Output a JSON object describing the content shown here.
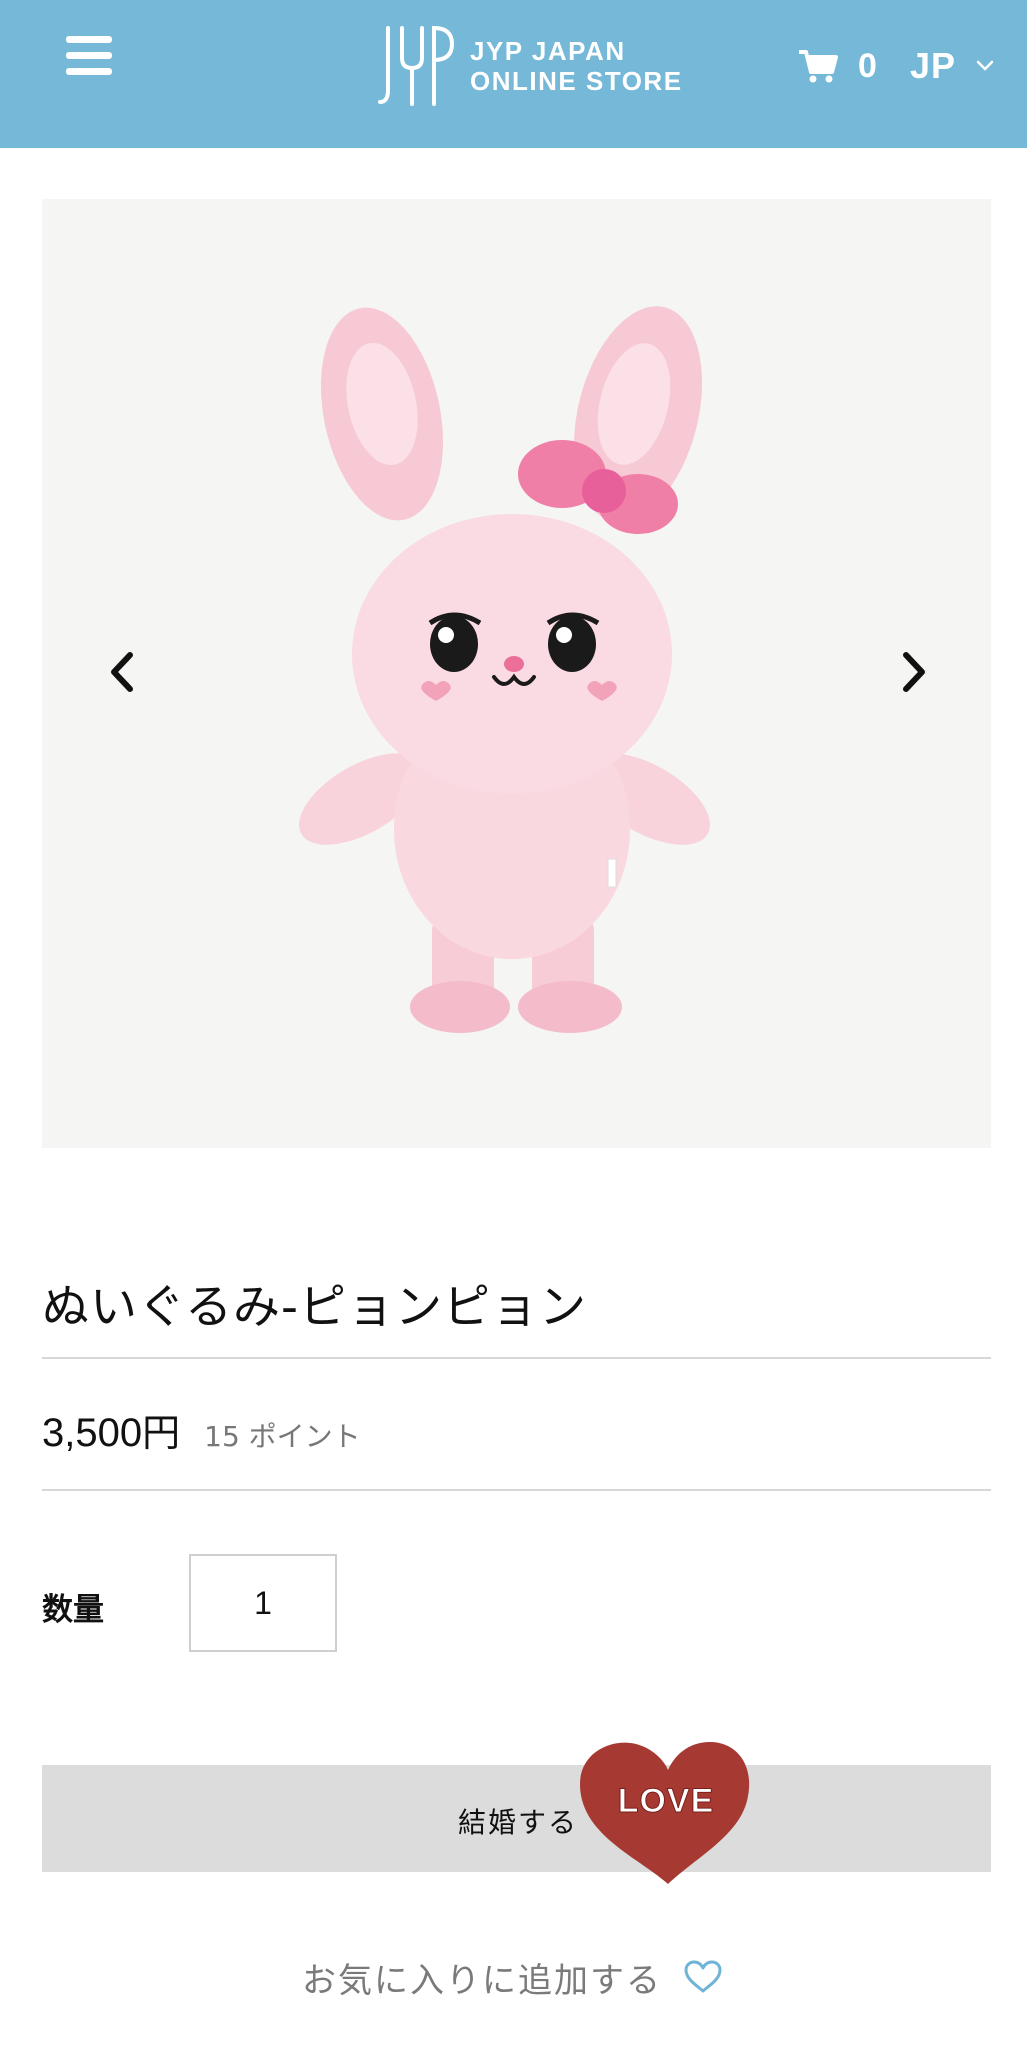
{
  "header": {
    "brand_line1": "JYP JAPAN",
    "brand_line2": "ONLINE STORE",
    "logo_mark": "JYP",
    "cart_count": "0",
    "language": "JP",
    "menu_icon": "hamburger-menu-icon",
    "cart_icon": "shopping-cart-icon",
    "language_dropdown_icon": "chevron-down-icon"
  },
  "gallery": {
    "prev_icon": "chevron-left-icon",
    "next_icon": "chevron-right-icon",
    "image": "pink bunny plush toy with bow"
  },
  "product": {
    "title": "ぬいぐるみ-ピョンピョン",
    "price_number": "3,500",
    "price_unit": "円",
    "points": "15 ポイント",
    "quantity_label": "数量",
    "quantity_value": "1"
  },
  "actions": {
    "add_to_cart_label": "結婚する",
    "sticker_text": "LOVE",
    "favorite_label": "お気に入りに追加する",
    "favorite_icon": "heart-outline-icon"
  },
  "colors": {
    "header_bg": "#75b8d7",
    "button_bg": "#dcdcdc",
    "sticker_red": "#a63a33",
    "heart_blue": "#6fb3d6"
  }
}
